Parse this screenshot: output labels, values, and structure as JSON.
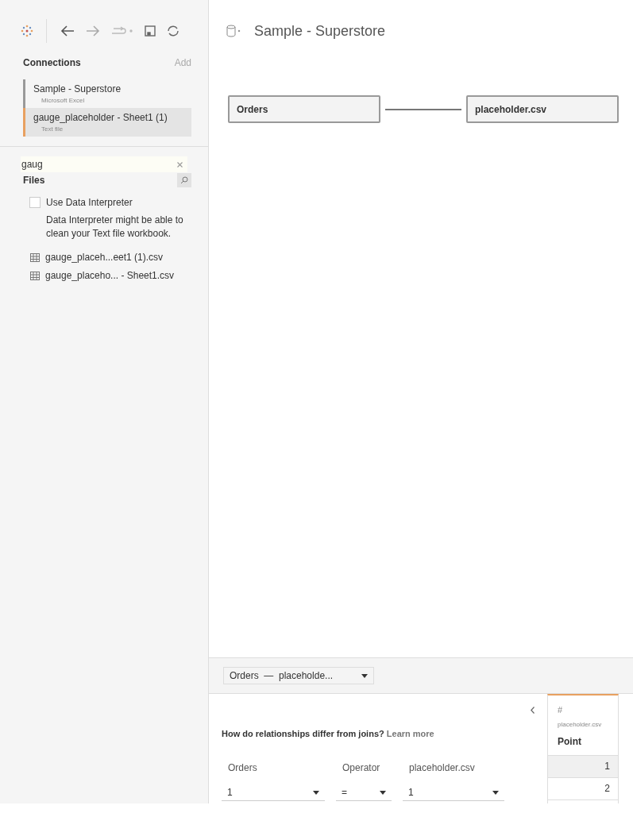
{
  "connections": {
    "title": "Connections",
    "add": "Add",
    "items": [
      {
        "name": "Sample - Superstore",
        "type": "Microsoft Excel",
        "selected": false
      },
      {
        "name": "gauge_placeholder - Sheet1 (1)",
        "type": "Text file",
        "selected": true
      }
    ]
  },
  "search": {
    "value": "gaug"
  },
  "files": {
    "title": "Files",
    "interpreter": {
      "label": "Use Data Interpreter",
      "checked": false
    },
    "note": "Data Interpreter might be able to clean your Text file workbook.",
    "items": [
      "gauge_placeh...eet1 (1).csv",
      "gauge_placeho... - Sheet1.csv"
    ]
  },
  "data_source": {
    "title": "Sample - Superstore"
  },
  "canvas": {
    "tables": [
      "Orders",
      "placeholder.csv"
    ]
  },
  "relationship_selector": {
    "value": "Orders  —  placeholde..."
  },
  "relationship": {
    "help": "How do relationships differ from joins?",
    "link": "Learn more",
    "fields": [
      {
        "header": "Orders",
        "value": "1"
      },
      {
        "header": "Operator",
        "value": "="
      },
      {
        "header": "placeholder.csv",
        "value": "1"
      }
    ]
  },
  "preview": {
    "type_icon": "#",
    "source": "placeholder.csv",
    "column": "Point",
    "rows": [
      {
        "value": "1",
        "selected": true
      },
      {
        "value": "2",
        "selected": false
      }
    ]
  }
}
